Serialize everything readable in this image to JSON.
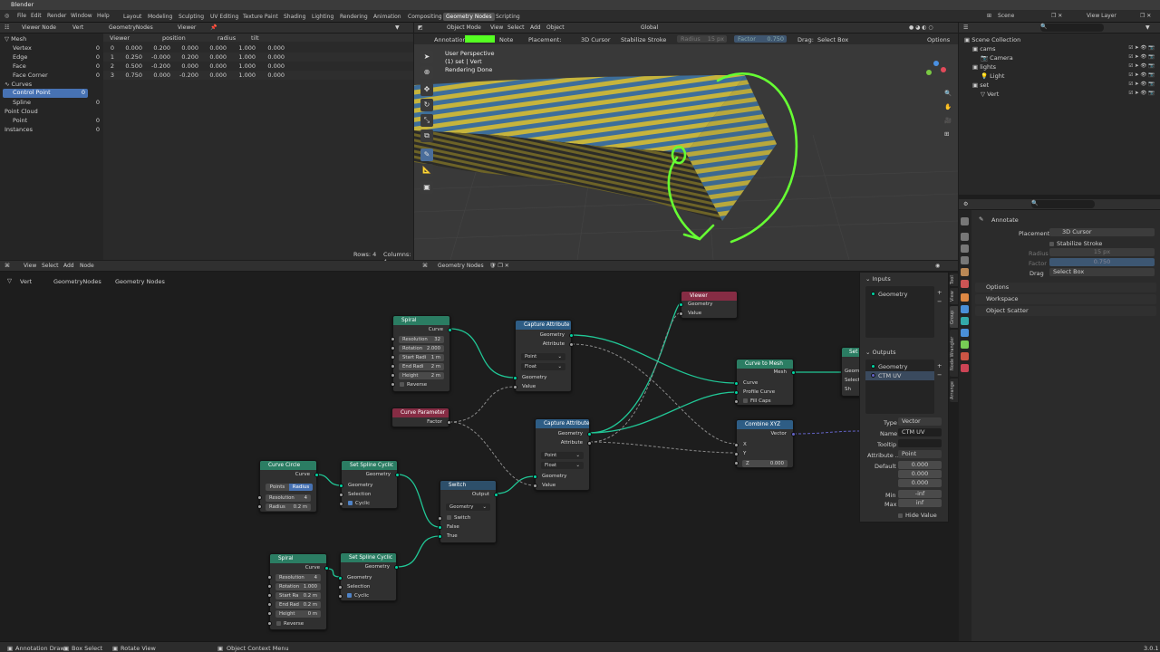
{
  "app": {
    "title": "Blender"
  },
  "menu": [
    "File",
    "Edit",
    "Render",
    "Window",
    "Help"
  ],
  "workspaces": [
    "Layout",
    "Modeling",
    "Sculpting",
    "UV Editing",
    "Texture Paint",
    "Shading",
    "Lighting",
    "Rendering",
    "Animation",
    "Compositing",
    "Geometry Nodes",
    "Scripting"
  ],
  "active_workspace": "Geometry Nodes",
  "scene": "Scene",
  "view_layer": "View Layer",
  "spreadsheet": {
    "header": {
      "viewer_node": "Viewer Node",
      "object": "Vert",
      "modifier": "GeometryNodes",
      "viewer": "Viewer"
    },
    "tree": [
      {
        "label": "Mesh",
        "count": ""
      },
      {
        "label": "Vertex",
        "count": "0"
      },
      {
        "label": "Edge",
        "count": "0"
      },
      {
        "label": "Face",
        "count": "0"
      },
      {
        "label": "Face Corner",
        "count": "0"
      },
      {
        "label": "Curves",
        "count": ""
      },
      {
        "label": "Control Point",
        "count": "0"
      },
      {
        "label": "Spline",
        "count": "0"
      },
      {
        "label": "Point Cloud",
        "count": ""
      },
      {
        "label": "Point",
        "count": "0"
      },
      {
        "label": "Instances",
        "count": "0"
      }
    ],
    "columns": [
      "",
      "Viewer",
      "position",
      "",
      "",
      "radius",
      "tilt"
    ],
    "rows": [
      [
        "0",
        "0.000",
        "0.200",
        "0.000",
        "0.000",
        "1.000",
        "0.000"
      ],
      [
        "1",
        "0.250",
        "-0.000",
        "0.200",
        "0.000",
        "1.000",
        "0.000"
      ],
      [
        "2",
        "0.500",
        "-0.200",
        "0.000",
        "0.000",
        "1.000",
        "0.000"
      ],
      [
        "3",
        "0.750",
        "0.000",
        "-0.200",
        "0.000",
        "1.000",
        "0.000"
      ]
    ],
    "footer": {
      "rows": "Rows: 4",
      "columns": "Columns: 4"
    }
  },
  "viewport": {
    "mode": "Object Mode",
    "menus": [
      "View",
      "Select",
      "Add",
      "Object"
    ],
    "transform": "Global",
    "annotation_label": "Annotation:",
    "annotation_color": "#55ff22",
    "note": "Note",
    "placement_label": "Placement:",
    "placement": "3D Cursor",
    "stabilize": "Stabilize Stroke",
    "radius": "Radius",
    "radius_val": "15 px",
    "factor": "Factor",
    "factor_val": "0.750",
    "drag": "Drag:",
    "drag_val": "Select Box",
    "options": "Options",
    "overlay": [
      "User Perspective",
      "(1) set | Vert",
      "Rendering Done"
    ]
  },
  "outliner": {
    "items": [
      {
        "label": "Scene Collection",
        "indent": 0
      },
      {
        "label": "cams",
        "indent": 1
      },
      {
        "label": "Camera",
        "indent": 2
      },
      {
        "label": "lights",
        "indent": 1
      },
      {
        "label": "Light",
        "indent": 2
      },
      {
        "label": "set",
        "indent": 1
      },
      {
        "label": "Vert",
        "indent": 2
      }
    ]
  },
  "properties": {
    "tool": "Annotate",
    "placement_label": "Placement",
    "placement": "3D Cursor",
    "stabilize": "Stabilize Stroke",
    "radius_label": "Radius",
    "radius": "15 px",
    "factor_label": "Factor",
    "factor": "0.750",
    "drag_label": "Drag",
    "drag": "Select Box",
    "panels": [
      "Options",
      "Workspace",
      "Object Scatter"
    ]
  },
  "node_editor": {
    "menus": [
      "View",
      "Select",
      "Add",
      "Node"
    ],
    "tree_name": "Geometry Nodes",
    "breadcrumb": {
      "object": "Vert",
      "modifier": "GeometryNodes",
      "tree": "Geometry Nodes"
    },
    "nodes": {
      "spiral1": {
        "title": "Spiral",
        "out": "Curve",
        "fields": [
          [
            "Resolution",
            "32"
          ],
          [
            "Rotation",
            "2.000"
          ],
          [
            "Start Radi",
            "1 m"
          ],
          [
            "End Radi",
            "2 m"
          ],
          [
            "Height",
            "2 m"
          ]
        ],
        "reverse": "Reverse"
      },
      "curve_param": {
        "title": "Curve Parameter",
        "out": "Factor"
      },
      "capture1": {
        "title": "Capture Attribute",
        "outs": [
          "Geometry",
          "Attribute"
        ],
        "domain": "Point",
        "type": "Float",
        "ins": [
          "Geometry",
          "Value"
        ]
      },
      "capture2": {
        "title": "Capture Attribute",
        "outs": [
          "Geometry",
          "Attribute"
        ],
        "domain": "Point",
        "type": "Float",
        "ins": [
          "Geometry",
          "Value"
        ]
      },
      "viewer": {
        "title": "Viewer",
        "ins": [
          "Geometry",
          "Value"
        ]
      },
      "curve_to_mesh": {
        "title": "Curve to Mesh",
        "out": "Mesh",
        "ins": [
          "Curve",
          "Profile Curve",
          "Fill Caps"
        ]
      },
      "combine": {
        "title": "Combine XYZ",
        "out": "Vector",
        "ins": [
          "X",
          "Y"
        ],
        "z": "Z",
        "z_val": "0.000"
      },
      "circle": {
        "title": "Curve Circle",
        "out": "Curve",
        "mode_a": "Points",
        "mode_b": "Radius",
        "fields": [
          [
            "Resolution",
            "4"
          ],
          [
            "Radius",
            "0.2 m"
          ]
        ]
      },
      "cyclic1": {
        "title": "Set Spline Cyclic",
        "out": "Geometry",
        "ins": [
          "Geometry",
          "Selection",
          "Cyclic"
        ]
      },
      "switch": {
        "title": "Switch",
        "out": "Output",
        "type": "Geometry",
        "ins": [
          "Switch",
          "False",
          "True"
        ]
      },
      "spiral2": {
        "title": "Spiral",
        "out": "Curve",
        "fields": [
          [
            "Resolution",
            "4"
          ],
          [
            "Rotation",
            "1.000"
          ],
          [
            "Start Ra",
            "0.2 m"
          ],
          [
            "End Rad",
            "0.2 m"
          ],
          [
            "Height",
            "0 m"
          ]
        ],
        "reverse": "Reverse"
      },
      "cyclic2": {
        "title": "Set Spline Cyclic",
        "out": "Geometry",
        "ins": [
          "Geometry",
          "Selection",
          "Cyclic"
        ]
      },
      "set_partial": {
        "title": "Set",
        "ins": [
          "Geom",
          "Select",
          "Sh"
        ]
      }
    },
    "side_panel": {
      "inputs": "Inputs",
      "input_items": [
        "Geometry"
      ],
      "outputs": "Outputs",
      "output_items": [
        "Geometry",
        "CTM UV"
      ],
      "type_label": "Type",
      "type": "Vector",
      "name_label": "Name",
      "name": "CTM UV",
      "tooltip_label": "Tooltip",
      "attr_label": "Attribute ...",
      "attr": "Point",
      "default_label": "Default",
      "defaults": [
        "0.000",
        "0.000",
        "0.000"
      ],
      "min_label": "Min",
      "min": "-inf",
      "max_label": "Max",
      "max": "inf",
      "hide": "Hide Value",
      "tabs": [
        "Tool",
        "View",
        "Group",
        "Node Wrangler",
        "Arrange"
      ]
    }
  },
  "statusbar": {
    "items": [
      "Annotation Draw",
      "Box Select",
      "Rotate View",
      "Object Context Menu"
    ],
    "version": "3.0.1"
  }
}
